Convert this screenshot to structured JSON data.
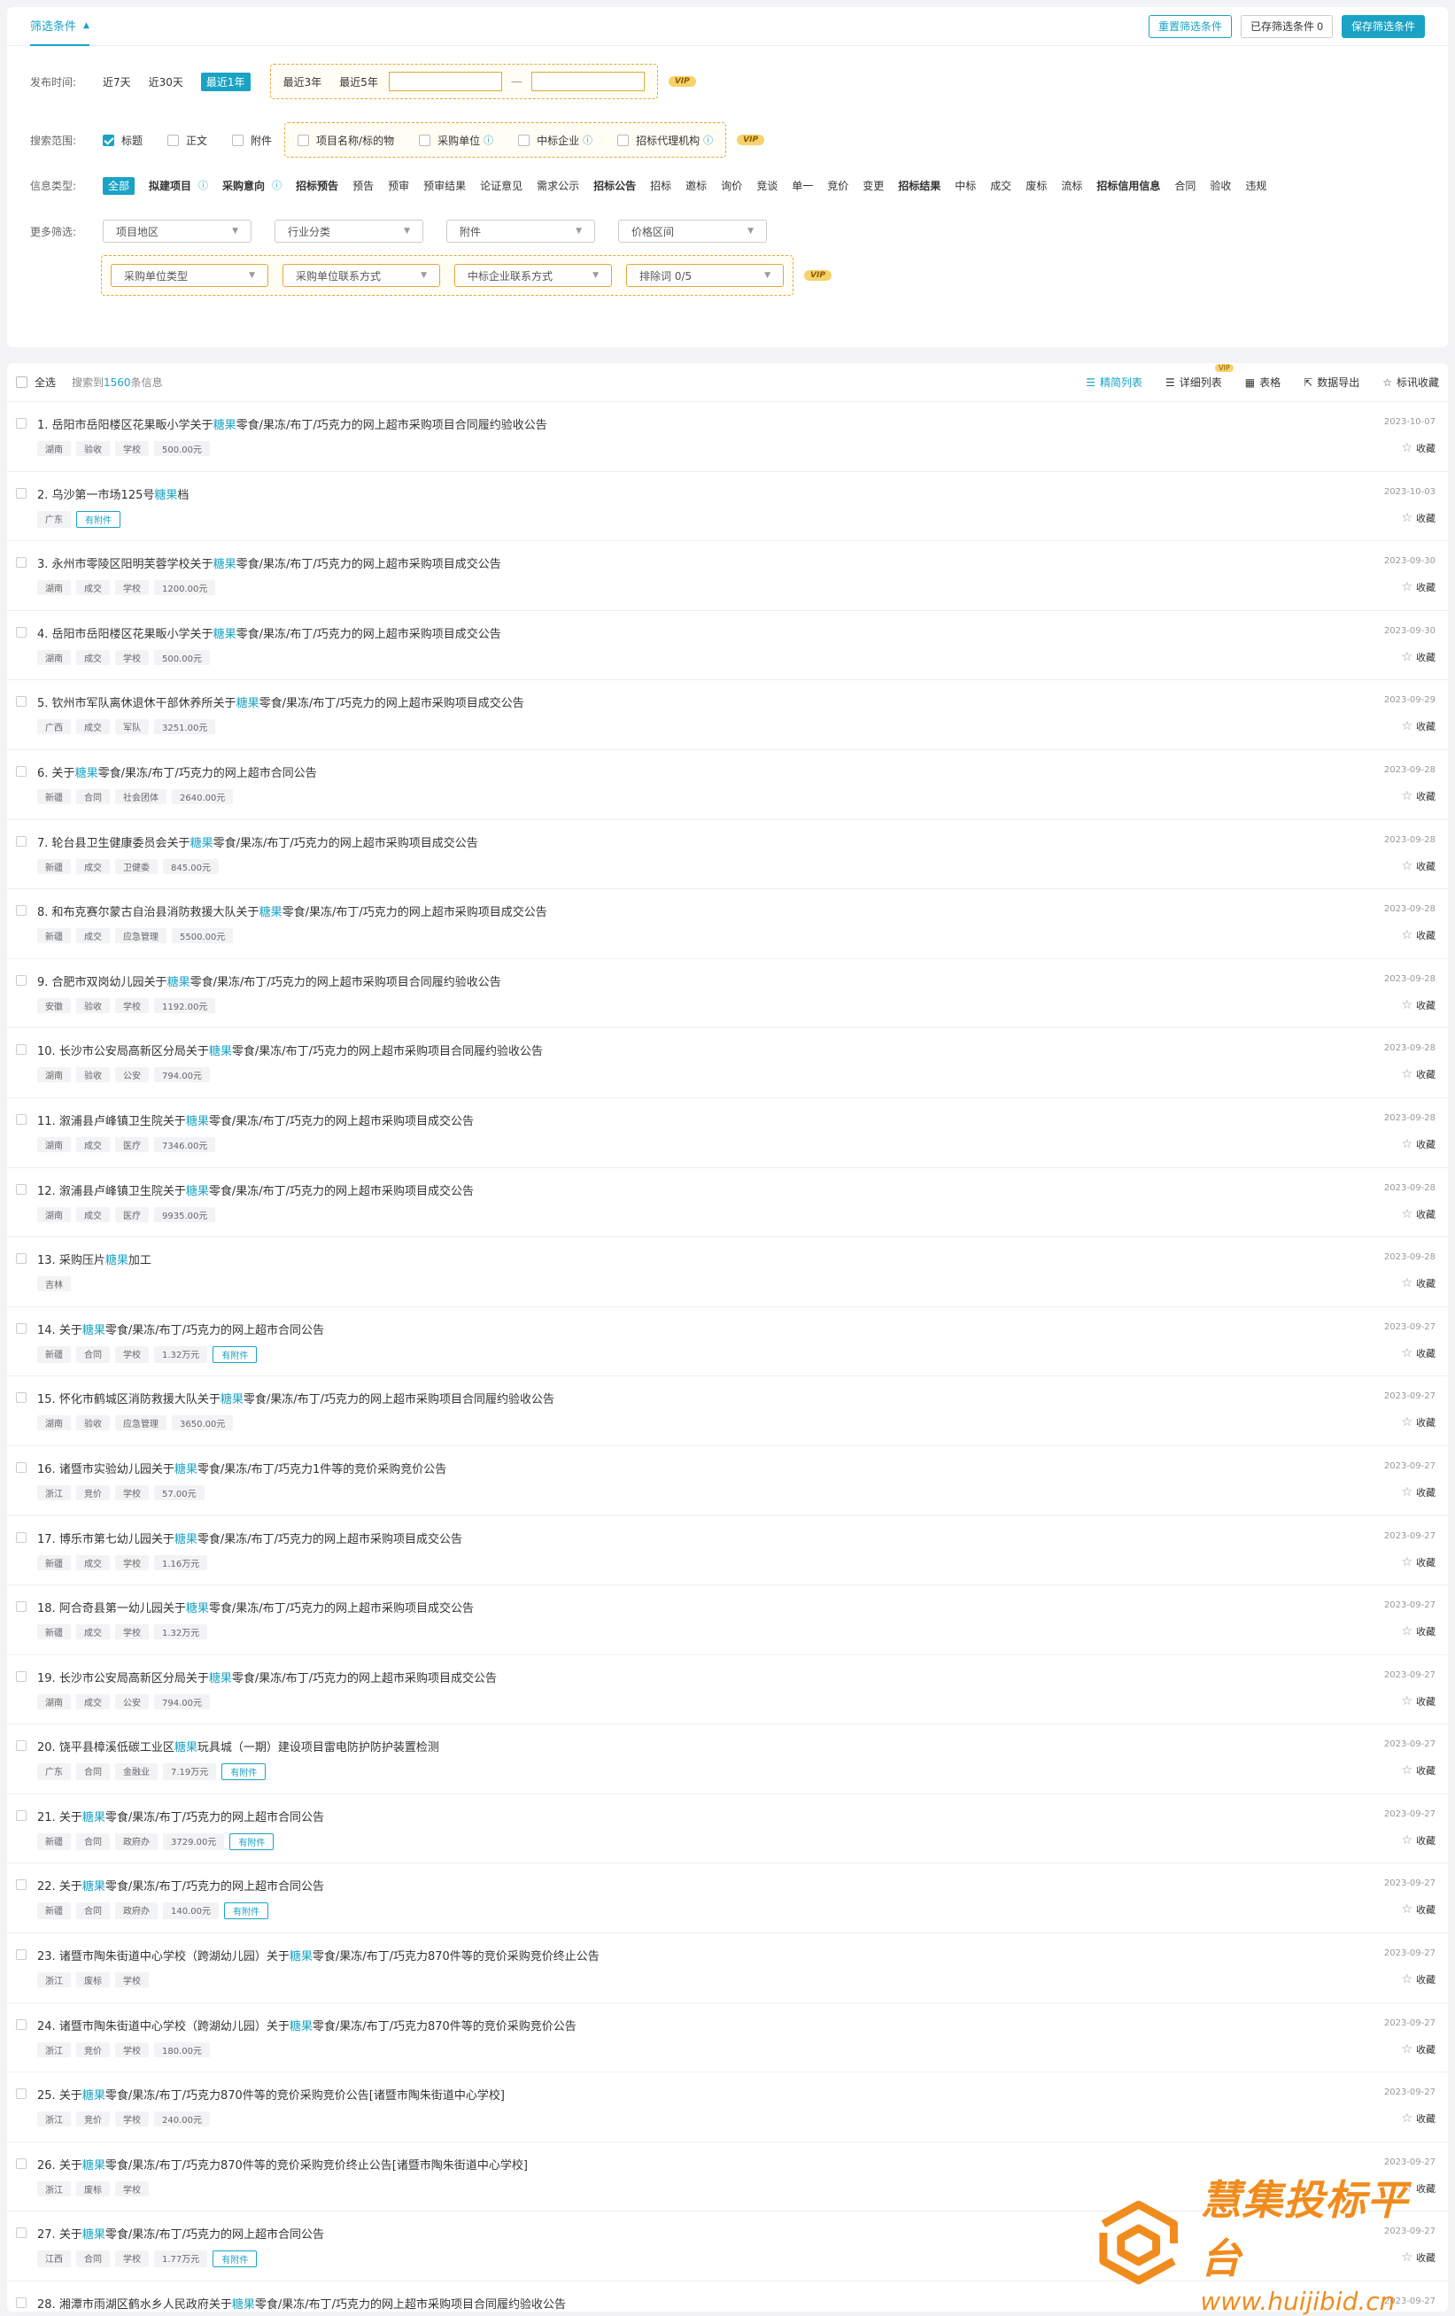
{
  "filter": {
    "tab_label": "筛选条件",
    "reset_label": "重置筛选条件",
    "saved_label": "已存筛选条件 0",
    "save_label": "保存筛选条件",
    "time": {
      "label": "发布时间:",
      "opts": [
        "近7天",
        "近30天",
        "最近1年"
      ],
      "vip_opts": [
        "最近3年",
        "最近5年"
      ],
      "dash": "—"
    },
    "scope": {
      "label": "搜索范围:",
      "opts": [
        "标题",
        "正文",
        "附件"
      ],
      "vip_opts": [
        "项目名称/标的物",
        "采购单位",
        "中标企业",
        "招标代理机构"
      ]
    },
    "types": {
      "label": "信息类型:",
      "items": [
        "全部",
        "拟建项目",
        "采购意向",
        "招标预告",
        "预告",
        "预审",
        "预审结果",
        "论证意见",
        "需求公示",
        "招标公告",
        "招标",
        "邀标",
        "询价",
        "竞谈",
        "单一",
        "竞价",
        "变更",
        "招标结果",
        "中标",
        "成交",
        "废标",
        "流标",
        "招标信用信息",
        "合同",
        "验收",
        "违规"
      ]
    },
    "more": {
      "label": "更多筛选:",
      "selects": [
        "项目地区",
        "行业分类",
        "附件",
        "价格区间"
      ],
      "vip_selects": [
        "采购单位类型",
        "采购单位联系方式",
        "中标企业联系方式",
        "排除词 0/5"
      ]
    },
    "vip_badge": "VIP"
  },
  "results": {
    "select_all": "全选",
    "count_prefix": "搜索到",
    "count": "1560",
    "count_suffix": "条信息",
    "views": [
      "精简列表",
      "详细列表",
      "表格",
      "数据导出",
      "标讯收藏"
    ],
    "vip_mini": "VIP",
    "fav_label": "收藏",
    "items": [
      {
        "n": "1.",
        "pre": "岳阳市岳阳楼区花果畈小学关于",
        "kw": "糖果",
        "post": "零食/果冻/布丁/巧克力的网上超市采购项目合同履约验收公告",
        "tags": [
          "湖南",
          "验收",
          "学校",
          "500.00元"
        ],
        "att": "",
        "date": "2023-10-07"
      },
      {
        "n": "2.",
        "pre": "乌沙第一市场125号",
        "kw": "糖果",
        "post": "档",
        "tags": [
          "广东"
        ],
        "att": "有附件",
        "date": "2023-10-03"
      },
      {
        "n": "3.",
        "pre": "永州市零陵区阳明芙蓉学校关于",
        "kw": "糖果",
        "post": "零食/果冻/布丁/巧克力的网上超市采购项目成交公告",
        "tags": [
          "湖南",
          "成交",
          "学校",
          "1200.00元"
        ],
        "att": "",
        "date": "2023-09-30"
      },
      {
        "n": "4.",
        "pre": "岳阳市岳阳楼区花果畈小学关于",
        "kw": "糖果",
        "post": "零食/果冻/布丁/巧克力的网上超市采购项目成交公告",
        "tags": [
          "湖南",
          "成交",
          "学校",
          "500.00元"
        ],
        "att": "",
        "date": "2023-09-30"
      },
      {
        "n": "5.",
        "pre": "钦州市军队离休退休干部休养所关于",
        "kw": "糖果",
        "post": "零食/果冻/布丁/巧克力的网上超市采购项目成交公告",
        "tags": [
          "广西",
          "成交",
          "军队",
          "3251.00元"
        ],
        "att": "",
        "date": "2023-09-29"
      },
      {
        "n": "6.",
        "pre": "关于",
        "kw": "糖果",
        "post": "零食/果冻/布丁/巧克力的网上超市合同公告",
        "tags": [
          "新疆",
          "合同",
          "社会团体",
          "2640.00元"
        ],
        "att": "",
        "date": "2023-09-28"
      },
      {
        "n": "7.",
        "pre": "轮台县卫生健康委员会关于",
        "kw": "糖果",
        "post": "零食/果冻/布丁/巧克力的网上超市采购项目成交公告",
        "tags": [
          "新疆",
          "成交",
          "卫健委",
          "845.00元"
        ],
        "att": "",
        "date": "2023-09-28"
      },
      {
        "n": "8.",
        "pre": "和布克赛尔蒙古自治县消防救援大队关于",
        "kw": "糖果",
        "post": "零食/果冻/布丁/巧克力的网上超市采购项目成交公告",
        "tags": [
          "新疆",
          "成交",
          "应急管理",
          "5500.00元"
        ],
        "att": "",
        "date": "2023-09-28"
      },
      {
        "n": "9.",
        "pre": "合肥市双岗幼儿园关于",
        "kw": "糖果",
        "post": "零食/果冻/布丁/巧克力的网上超市采购项目合同履约验收公告",
        "tags": [
          "安徽",
          "验收",
          "学校",
          "1192.00元"
        ],
        "att": "",
        "date": "2023-09-28"
      },
      {
        "n": "10.",
        "pre": "长沙市公安局高新区分局关于",
        "kw": "糖果",
        "post": "零食/果冻/布丁/巧克力的网上超市采购项目合同履约验收公告",
        "tags": [
          "湖南",
          "验收",
          "公安",
          "794.00元"
        ],
        "att": "",
        "date": "2023-09-28"
      },
      {
        "n": "11.",
        "pre": "溆浦县卢峰镇卫生院关于",
        "kw": "糖果",
        "post": "零食/果冻/布丁/巧克力的网上超市采购项目成交公告",
        "tags": [
          "湖南",
          "成交",
          "医疗",
          "7346.00元"
        ],
        "att": "",
        "date": "2023-09-28"
      },
      {
        "n": "12.",
        "pre": "溆浦县卢峰镇卫生院关于",
        "kw": "糖果",
        "post": "零食/果冻/布丁/巧克力的网上超市采购项目成交公告",
        "tags": [
          "湖南",
          "成交",
          "医疗",
          "9935.00元"
        ],
        "att": "",
        "date": "2023-09-28"
      },
      {
        "n": "13.",
        "pre": "采购压片",
        "kw": "糖果",
        "post": "加工",
        "tags": [
          "吉林"
        ],
        "att": "",
        "date": "2023-09-28"
      },
      {
        "n": "14.",
        "pre": "关于",
        "kw": "糖果",
        "post": "零食/果冻/布丁/巧克力的网上超市合同公告",
        "tags": [
          "新疆",
          "合同",
          "学校",
          "1.32万元"
        ],
        "att": "有附件",
        "date": "2023-09-27"
      },
      {
        "n": "15.",
        "pre": "怀化市鹤城区消防救援大队关于",
        "kw": "糖果",
        "post": "零食/果冻/布丁/巧克力的网上超市采购项目合同履约验收公告",
        "tags": [
          "湖南",
          "验收",
          "应急管理",
          "3650.00元"
        ],
        "att": "",
        "date": "2023-09-27"
      },
      {
        "n": "16.",
        "pre": "诸暨市实验幼儿园关于",
        "kw": "糖果",
        "post": "零食/果冻/布丁/巧克力1件等的竞价采购竞价公告",
        "tags": [
          "浙江",
          "竞价",
          "学校",
          "57.00元"
        ],
        "att": "",
        "date": "2023-09-27"
      },
      {
        "n": "17.",
        "pre": "博乐市第七幼儿园关于",
        "kw": "糖果",
        "post": "零食/果冻/布丁/巧克力的网上超市采购项目成交公告",
        "tags": [
          "新疆",
          "成交",
          "学校",
          "1.16万元"
        ],
        "att": "",
        "date": "2023-09-27"
      },
      {
        "n": "18.",
        "pre": "阿合奇县第一幼儿园关于",
        "kw": "糖果",
        "post": "零食/果冻/布丁/巧克力的网上超市采购项目成交公告",
        "tags": [
          "新疆",
          "成交",
          "学校",
          "1.32万元"
        ],
        "att": "",
        "date": "2023-09-27"
      },
      {
        "n": "19.",
        "pre": "长沙市公安局高新区分局关于",
        "kw": "糖果",
        "post": "零食/果冻/布丁/巧克力的网上超市采购项目成交公告",
        "tags": [
          "湖南",
          "成交",
          "公安",
          "794.00元"
        ],
        "att": "",
        "date": "2023-09-27"
      },
      {
        "n": "20.",
        "pre": "饶平县樟溪低碳工业区",
        "kw": "糖果",
        "post": "玩具城（一期）建设项目雷电防护防护装置检测",
        "tags": [
          "广东",
          "合同",
          "金融业",
          "7.19万元"
        ],
        "att": "有附件",
        "date": "2023-09-27"
      },
      {
        "n": "21.",
        "pre": "关于",
        "kw": "糖果",
        "post": "零食/果冻/布丁/巧克力的网上超市合同公告",
        "tags": [
          "新疆",
          "合同",
          "政府办",
          "3729.00元"
        ],
        "att": "有附件",
        "date": "2023-09-27"
      },
      {
        "n": "22.",
        "pre": "关于",
        "kw": "糖果",
        "post": "零食/果冻/布丁/巧克力的网上超市合同公告",
        "tags": [
          "新疆",
          "合同",
          "政府办",
          "140.00元"
        ],
        "att": "有附件",
        "date": "2023-09-27"
      },
      {
        "n": "23.",
        "pre": "诸暨市陶朱街道中心学校（跨湖幼儿园）关于",
        "kw": "糖果",
        "post": "零食/果冻/布丁/巧克力870件等的竞价采购竞价终止公告",
        "tags": [
          "浙江",
          "废标",
          "学校"
        ],
        "att": "",
        "date": "2023-09-27"
      },
      {
        "n": "24.",
        "pre": "诸暨市陶朱街道中心学校（跨湖幼儿园）关于",
        "kw": "糖果",
        "post": "零食/果冻/布丁/巧克力870件等的竞价采购竞价公告",
        "tags": [
          "浙江",
          "竞价",
          "学校",
          "180.00元"
        ],
        "att": "",
        "date": "2023-09-27"
      },
      {
        "n": "25.",
        "pre": "关于",
        "kw": "糖果",
        "post": "零食/果冻/布丁/巧克力870件等的竞价采购竞价公告[诸暨市陶朱街道中心学校]",
        "tags": [
          "浙江",
          "竞价",
          "学校",
          "240.00元"
        ],
        "att": "",
        "date": "2023-09-27"
      },
      {
        "n": "26.",
        "pre": "关于",
        "kw": "糖果",
        "post": "零食/果冻/布丁/巧克力870件等的竞价采购竞价终止公告[诸暨市陶朱街道中心学校]",
        "tags": [
          "浙江",
          "废标",
          "学校"
        ],
        "att": "",
        "date": "2023-09-27"
      },
      {
        "n": "27.",
        "pre": "关于",
        "kw": "糖果",
        "post": "零食/果冻/布丁/巧克力的网上超市合同公告",
        "tags": [
          "江西",
          "合同",
          "学校",
          "1.77万元"
        ],
        "att": "有附件",
        "date": "2023-09-27"
      },
      {
        "n": "28.",
        "pre": "湘潭市雨湖区鹤水乡人民政府关于",
        "kw": "糖果",
        "post": "零食/果冻/布丁/巧克力的网上超市采购项目合同履约验收公告",
        "tags": [],
        "att": "",
        "date": "2023-09-27"
      }
    ]
  },
  "logo": {
    "name": "慧集投标平台",
    "url": "www.huijibid.cn",
    "color": "#f08c1d"
  },
  "colors": {
    "accent": "#1aa3c5",
    "vip": "#e3a73a"
  }
}
